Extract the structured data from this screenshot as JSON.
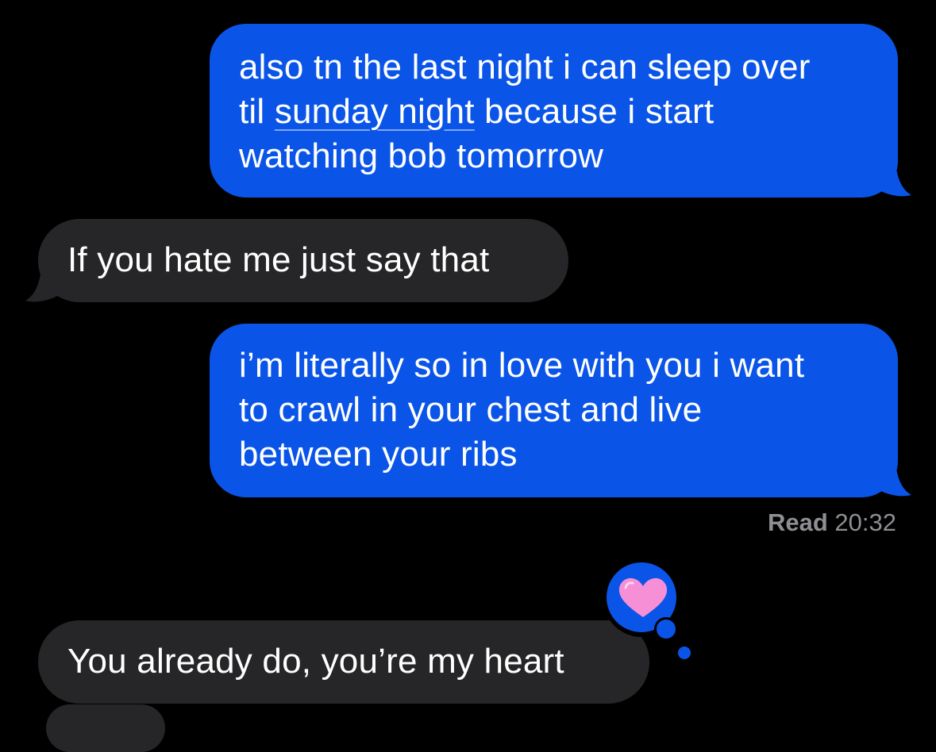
{
  "messages": [
    {
      "direction": "sent",
      "text_before_link": "also tn the last night i can sleep over",
      "line2_prefix": "til ",
      "link_text": "sunday night",
      "line2_suffix": " because i start",
      "line3": "watching bob tomorrow"
    },
    {
      "direction": "received",
      "text": "If you hate me just say that"
    },
    {
      "direction": "sent",
      "line1": "i’m literally so in love with you i want",
      "line2": "to crawl in your chest and live",
      "line3": "between your ribs"
    },
    {
      "direction": "received",
      "text": "You already do, you’re my heart",
      "tapback": "heart-icon"
    }
  ],
  "read_receipt": {
    "label": "Read",
    "time": "20:32"
  },
  "colors": {
    "background": "#000000",
    "sent_bubble": "#0a55e8",
    "received_bubble": "#262628",
    "text": "#ffffff",
    "receipt": "#8e8e93",
    "heart": "#f78fd6"
  }
}
